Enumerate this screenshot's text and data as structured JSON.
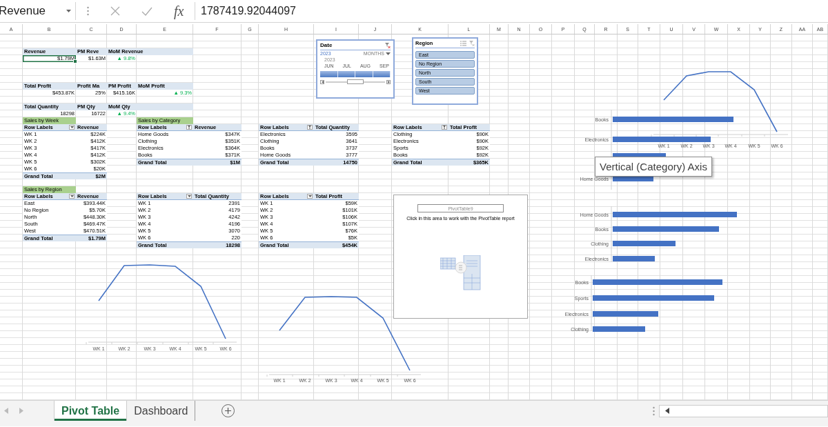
{
  "formula_bar": {
    "name_box": "Revenue",
    "function_label": "fx",
    "value": "1787419.92044097"
  },
  "columns": [
    "A",
    "B",
    "C",
    "D",
    "E",
    "F",
    "G",
    "H",
    "I",
    "J",
    "K",
    "L",
    "M",
    "N",
    "O",
    "P",
    "Q",
    "R",
    "S",
    "T",
    "U",
    "V",
    "W",
    "X",
    "Y",
    "Z",
    "AA",
    "AB"
  ],
  "kpis": [
    {
      "headers": [
        "Revenue",
        "PM Reve",
        "MoM Revenue"
      ],
      "values": [
        {
          "text": "$1.79M",
          "kind": "number",
          "selected": true
        },
        {
          "text": "$1.63M",
          "kind": "number",
          "selected": false
        },
        {
          "text": "▲ 9.8%",
          "kind": "trend",
          "selected": false
        }
      ]
    },
    {
      "headers": [
        "Total Profit",
        "Profit Ma",
        "PM Profit",
        "MoM Profit"
      ],
      "values": [
        {
          "text": "$453.87K",
          "kind": "number",
          "selected": false
        },
        {
          "text": "25%",
          "kind": "number",
          "selected": false
        },
        {
          "text": "$415.16K",
          "kind": "number",
          "selected": false
        },
        {
          "text": "▲ 9.3%",
          "kind": "trend",
          "selected": false
        }
      ]
    },
    {
      "headers": [
        "Total Quantity",
        "PM Qty",
        "MoM Qty"
      ],
      "values": [
        {
          "text": "18298",
          "kind": "number",
          "selected": false
        },
        {
          "text": "16722",
          "kind": "number",
          "selected": false
        },
        {
          "text": "▲ 9.4%",
          "kind": "trend",
          "selected": false
        }
      ]
    }
  ],
  "pivot_tables": [
    {
      "title": "Sales by Week",
      "kind": "dropdown",
      "row_header": "Row Labels",
      "value_header": "Revenue",
      "rows": [
        [
          "WK 1",
          "$224K"
        ],
        [
          "WK 2",
          "$412K"
        ],
        [
          "WK 3",
          "$417K"
        ],
        [
          "WK 4",
          "$412K"
        ],
        [
          "WK 5",
          "$302K"
        ],
        [
          "WK 6",
          "$20K"
        ]
      ],
      "total": [
        "Grand Total",
        "$2M"
      ]
    },
    {
      "title": "Sales by Category",
      "kind": "sorted",
      "row_header": "Row Labels",
      "value_header": "Revenue",
      "rows": [
        [
          "Home Goods",
          "$347K"
        ],
        [
          "Clothing",
          "$351K"
        ],
        [
          "Electronics",
          "$364K"
        ],
        [
          "Books",
          "$371K"
        ]
      ],
      "total": [
        "Grand Total",
        "$1M"
      ]
    },
    {
      "kind": "sorted",
      "row_header": "Row Labels",
      "value_header": "Total Quantity",
      "rows": [
        [
          "Electronics",
          "3595"
        ],
        [
          "Clothing",
          "3641"
        ],
        [
          "Books",
          "3737"
        ],
        [
          "Home Goods",
          "3777"
        ]
      ],
      "total": [
        "Grand Total",
        "14750"
      ]
    },
    {
      "kind": "sorted",
      "row_header": "Row Labels",
      "value_header": "Total Profit",
      "rows": [
        [
          "Clothing",
          "$90K"
        ],
        [
          "Electronics",
          "$90K"
        ],
        [
          "Sports",
          "$92K"
        ],
        [
          "Books",
          "$92K"
        ]
      ],
      "total": [
        "Grand Total",
        "$365K"
      ]
    },
    {
      "title": "Sales by Region",
      "kind": "dropdown",
      "row_header": "Row Labels",
      "value_header": "Revenue",
      "rows": [
        [
          "East",
          "$393.44K"
        ],
        [
          "No Region",
          "$5.70K"
        ],
        [
          "North",
          "$448.30K"
        ],
        [
          "South",
          "$469.47K"
        ],
        [
          "West",
          "$470.51K"
        ]
      ],
      "total": [
        "Grand Total",
        "$1.79M"
      ]
    },
    {
      "kind": "dropdown",
      "row_header": "Row Labels",
      "value_header": "Total Quantity",
      "rows": [
        [
          "WK 1",
          "2391"
        ],
        [
          "WK 2",
          "4179"
        ],
        [
          "WK 3",
          "4242"
        ],
        [
          "WK 4",
          "4196"
        ],
        [
          "WK 5",
          "3070"
        ],
        [
          "WK 6",
          "220"
        ]
      ],
      "total": [
        "Grand Total",
        "18298"
      ]
    },
    {
      "kind": "dropdown",
      "row_header": "Row Labels",
      "value_header": "Total Profit",
      "rows": [
        [
          "WK 1",
          "$59K"
        ],
        [
          "WK 2",
          "$101K"
        ],
        [
          "WK 3",
          "$106K"
        ],
        [
          "WK 4",
          "$107K"
        ],
        [
          "WK 5",
          "$76K"
        ],
        [
          "WK 6",
          "$5K"
        ]
      ],
      "total": [
        "Grand Total",
        "$454K"
      ]
    }
  ],
  "timeline": {
    "title": "Date",
    "year": "2023",
    "level": "MONTHS",
    "sub_year": "2023",
    "months": [
      "JUN",
      "JUL",
      "AUG",
      "SEP"
    ]
  },
  "region_slicer": {
    "title": "Region",
    "items": [
      {
        "label": "East",
        "selected": true
      },
      {
        "label": "No Region",
        "selected": true
      },
      {
        "label": "North",
        "selected": true
      },
      {
        "label": "South",
        "selected": true
      },
      {
        "label": "West",
        "selected": true
      }
    ]
  },
  "placeholder": {
    "name": "PivotTable9",
    "message": "Click in this area to work with the PivotTable report"
  },
  "line_charts": [
    {
      "x_labels": [
        "WK 1",
        "WK 2",
        "WK 3",
        "WK 4",
        "WK 5",
        "WK 6"
      ]
    },
    {
      "x_labels": [
        "WK 1",
        "WK 2",
        "WK 3",
        "WK 4",
        "WK 5",
        "WK 6"
      ]
    },
    {
      "x_labels": [
        "WK 1",
        "WK 2",
        "WK 3",
        "WK 4",
        "WK 5",
        "WK 6"
      ]
    }
  ],
  "bar_charts": [
    {
      "categories": [
        "Books",
        "Electronics",
        "Home Goods"
      ]
    },
    {
      "categories": [
        "Home Goods",
        "Books",
        "Clothing",
        "Electronics"
      ]
    },
    {
      "categories": [
        "Books",
        "Sports",
        "Electronics",
        "Clothing"
      ]
    }
  ],
  "tooltip": "Vertical (Category) Axis",
  "sheet_tabs": [
    {
      "label": "Pivot Table",
      "selected": true
    },
    {
      "label": "Dashboard",
      "selected": false
    }
  ]
}
